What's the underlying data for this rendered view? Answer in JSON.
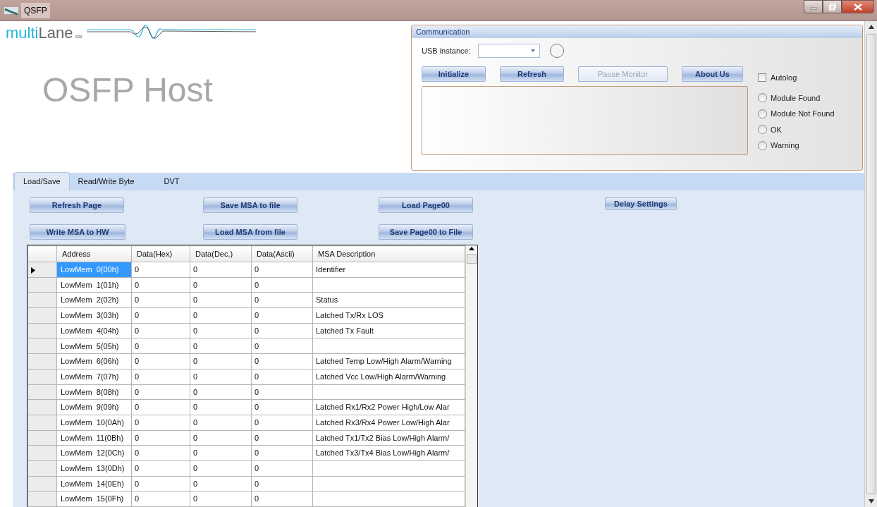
{
  "window": {
    "title": "QSFP"
  },
  "logo": {
    "part_1": "multi",
    "part_2": "Lane",
    "suffix": "sal"
  },
  "app_title": "OSFP Host",
  "communication": {
    "title": "Communication",
    "usb_label": "USB instance:",
    "buttons": [
      {
        "label": "Initialize",
        "disabled": false
      },
      {
        "label": "Refresh",
        "disabled": false
      },
      {
        "label": "Pause Monitor",
        "disabled": true
      },
      {
        "label": "About Us",
        "disabled": false
      }
    ],
    "autolog": {
      "label": "Autolog",
      "checked": false
    },
    "status_options": [
      {
        "label": "Module Found",
        "selected": false
      },
      {
        "label": "Module Not Found",
        "selected": false
      },
      {
        "label": "OK",
        "selected": false
      },
      {
        "label": "Warning",
        "selected": false
      }
    ]
  },
  "tabs": [
    {
      "label": "Load/Save",
      "selected": true
    },
    {
      "label": "Read/Write Byte",
      "selected": false
    },
    {
      "label": "DVT",
      "selected": false
    }
  ],
  "action_rows": [
    [
      "Refresh Page",
      "Save MSA to file",
      "Load Page00",
      "Delay Settings"
    ],
    [
      "Write MSA to HW",
      "Load MSA from file",
      "Save Page00 to File"
    ]
  ],
  "table": {
    "columns": [
      "Address",
      "Data(Hex)",
      "Data(Dec.)",
      "Data(Ascii)",
      "MSA Description"
    ],
    "rows": [
      {
        "selected": true,
        "cells": [
          "LowMem  0(00h)",
          "0",
          "0",
          "0",
          "Identifier"
        ]
      },
      {
        "selected": false,
        "cells": [
          "LowMem  1(01h)",
          "0",
          "0",
          "0",
          ""
        ]
      },
      {
        "selected": false,
        "cells": [
          "LowMem  2(02h)",
          "0",
          "0",
          "0",
          "Status"
        ]
      },
      {
        "selected": false,
        "cells": [
          "LowMem  3(03h)",
          "0",
          "0",
          "0",
          "Latched Tx/Rx LOS"
        ]
      },
      {
        "selected": false,
        "cells": [
          "LowMem  4(04h)",
          "0",
          "0",
          "0",
          "Latched Tx Fault"
        ]
      },
      {
        "selected": false,
        "cells": [
          "LowMem  5(05h)",
          "0",
          "0",
          "0",
          ""
        ]
      },
      {
        "selected": false,
        "cells": [
          "LowMem  6(06h)",
          "0",
          "0",
          "0",
          "Latched Temp Low/High Alarm/Warning"
        ]
      },
      {
        "selected": false,
        "cells": [
          "LowMem  7(07h)",
          "0",
          "0",
          "0",
          "Latched Vcc Low/High Alarm/Warning"
        ]
      },
      {
        "selected": false,
        "cells": [
          "LowMem  8(08h)",
          "0",
          "0",
          "0",
          ""
        ]
      },
      {
        "selected": false,
        "cells": [
          "LowMem  9(09h)",
          "0",
          "0",
          "0",
          "Latched Rx1/Rx2 Power High/Low Alar"
        ]
      },
      {
        "selected": false,
        "cells": [
          "LowMem  10(0Ah)",
          "0",
          "0",
          "0",
          "Latched Rx3/Rx4 Power Low/High Alar"
        ]
      },
      {
        "selected": false,
        "cells": [
          "LowMem  11(0Bh)",
          "0",
          "0",
          "0",
          "Latched Tx1/Tx2 Bias Low/High Alarm/"
        ]
      },
      {
        "selected": false,
        "cells": [
          "LowMem  12(0Ch)",
          "0",
          "0",
          "0",
          "Latched Tx3/Tx4 Bias Low/High Alarm/"
        ]
      },
      {
        "selected": false,
        "cells": [
          "LowMem  13(0Dh)",
          "0",
          "0",
          "0",
          ""
        ]
      },
      {
        "selected": false,
        "cells": [
          "LowMem  14(0Eh)",
          "0",
          "0",
          "0",
          ""
        ]
      },
      {
        "selected": false,
        "cells": [
          "LowMem  15(0Fh)",
          "0",
          "0",
          "0",
          ""
        ]
      }
    ]
  }
}
